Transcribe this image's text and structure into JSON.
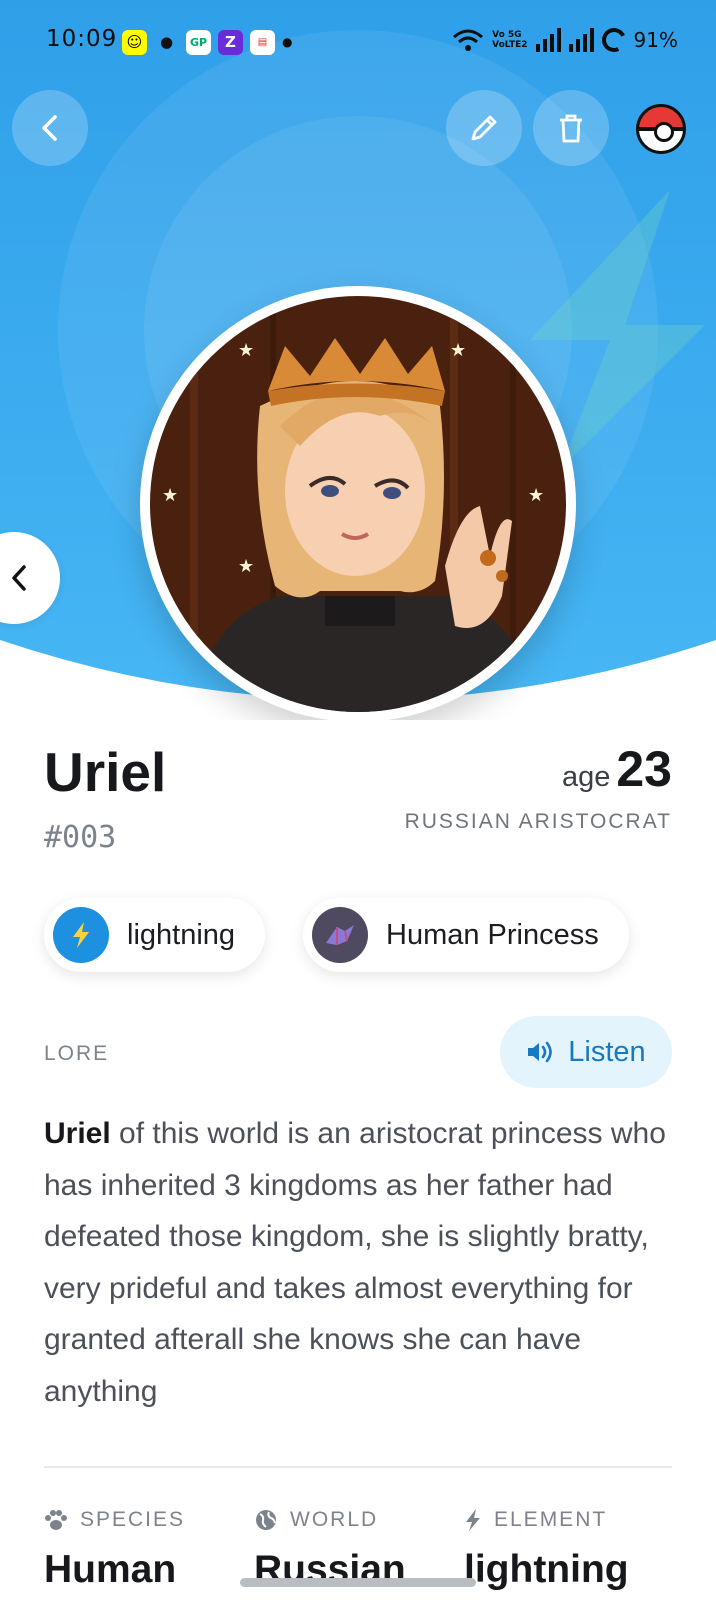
{
  "status_bar": {
    "time": "10:09",
    "volte_line1": "Vo 5G",
    "volte_line2": "VoLTE2",
    "battery": "91%",
    "notification_icons": [
      "snapchat-icon",
      "chat-icon",
      "gp-icon",
      "z-icon",
      "news-icon",
      "dot-icon"
    ]
  },
  "header": {
    "back_icon": "chevron-left-icon",
    "edit_icon": "pencil-icon",
    "delete_icon": "trash-icon",
    "pokeball_icon": "pokeball-icon"
  },
  "colors": {
    "hero_blue": "#3aaaf0",
    "accent_blue": "#1579c3",
    "lightning_chip": "#1e90e0"
  },
  "character": {
    "name": "Uriel",
    "number": "#003",
    "age_label": "age",
    "age": "23",
    "subtitle": "RUSSIAN ARISTOCRAT",
    "tags": [
      {
        "label": "lightning",
        "icon": "lightning-icon"
      },
      {
        "label": "Human Princess",
        "icon": "crystal-icon"
      }
    ]
  },
  "lore": {
    "section_label": "LORE",
    "listen_label": "Listen",
    "name_bold": "Uriel",
    "text": " of this world is an aristocrat princess who has inherited 3 kingdoms as her father had defeated those kingdom, she is slightly bratty, very prideful and takes almost everything for granted afterall she knows she can have anything"
  },
  "stats": [
    {
      "label": "SPECIES",
      "value": "Human",
      "icon": "paw-icon"
    },
    {
      "label": "WORLD",
      "value": "Russian",
      "icon": "globe-icon"
    },
    {
      "label": "ELEMENT",
      "value": "lightning",
      "icon": "bolt-icon"
    }
  ]
}
